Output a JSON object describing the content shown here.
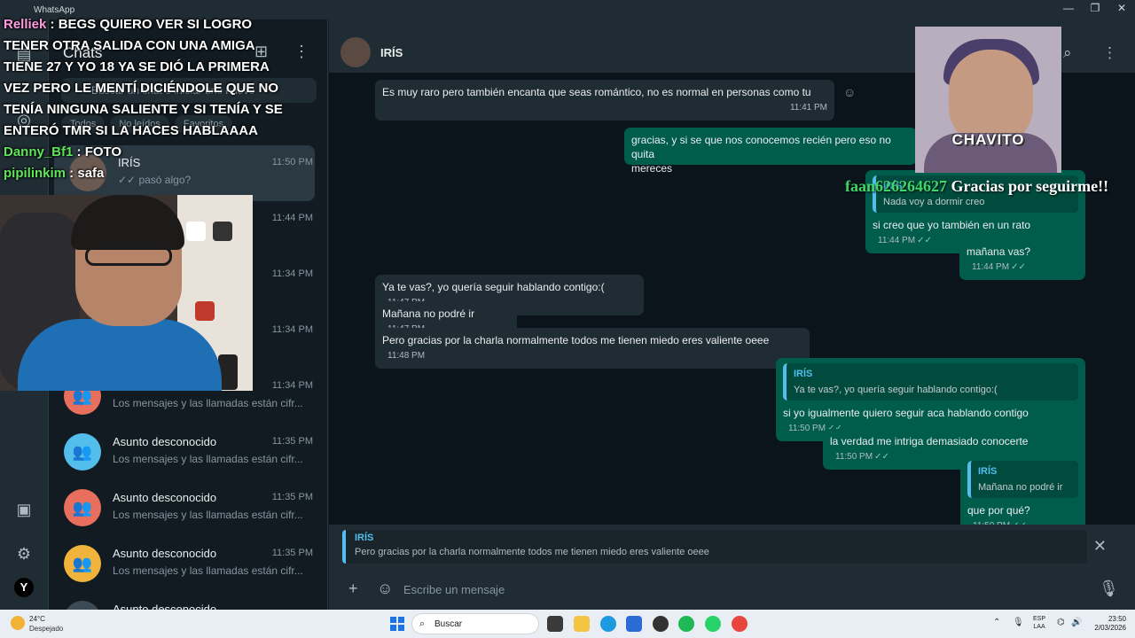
{
  "window": {
    "app_title": "WhatsApp",
    "controls": [
      "—",
      "❐",
      "✕"
    ]
  },
  "rail": {
    "icons": [
      "chats-icon",
      "status-icon",
      "channels-icon",
      "archive-icon",
      "settings-icon"
    ],
    "profile_initial": "Y"
  },
  "chat_list": {
    "title": "Chats",
    "search_placeholder": "Buscar un chat o iniciar uno nuevo",
    "filters": [
      "Todos",
      "No leídos",
      "Favoritos"
    ],
    "items": [
      {
        "name": "IRÍS",
        "time": "11:50 PM",
        "preview": "✓✓ pasó algo?",
        "color": "#6b5a52",
        "glyph": "",
        "active": true
      },
      {
        "name": "",
        "time": "11:44 PM",
        "preview": "",
        "color": "#3b4a54",
        "glyph": ""
      },
      {
        "name": "",
        "time": "11:34 PM",
        "preview": "están cifr...",
        "color": "#3b4a54",
        "glyph": ""
      },
      {
        "name": "",
        "time": "11:34 PM",
        "preview": "están cifr...",
        "color": "#3b4a54",
        "glyph": ""
      },
      {
        "name": "",
        "time": "11:34 PM",
        "preview": "Los mensajes y las llamadas están cifr...",
        "color": "#e86f5d",
        "glyph": "👥"
      },
      {
        "name": "Asunto desconocido",
        "time": "11:35 PM",
        "preview": "Los mensajes y las llamadas están cifr...",
        "color": "#53bdeb",
        "glyph": "👥"
      },
      {
        "name": "Asunto desconocido",
        "time": "11:35 PM",
        "preview": "Los mensajes y las llamadas están cifr...",
        "color": "#e86f5d",
        "glyph": "👥"
      },
      {
        "name": "Asunto desconocido",
        "time": "11:35 PM",
        "preview": "Los mensajes y las llamadas están cifr...",
        "color": "#f0b43c",
        "glyph": "👥"
      },
      {
        "name": "Asunto desconocido",
        "time": "",
        "preview": "",
        "color": "#3b4a54",
        "glyph": ""
      }
    ]
  },
  "chat": {
    "contact_name": "IRÍS",
    "messages": {
      "m1": {
        "text": "Es muy raro pero también encanta que seas romántico, no es normal en personas como tu",
        "time": "11:41 PM"
      },
      "m2": {
        "text": "gracias, y si se que nos conocemos recién pero eso no quita",
        "text2": "mereces"
      },
      "m3": {
        "quote_name": "IRÍS",
        "quote_text": "Nada voy a dormir creo",
        "text": "si creo que yo también en un rato",
        "time": "11:44 PM"
      },
      "m4": {
        "text": "mañana vas?",
        "time": "11:44 PM"
      },
      "m5": {
        "text": "Ya te vas?, yo quería seguir hablando contigo:(",
        "time": "11:47 PM"
      },
      "m6": {
        "text": "Mañana no podré ir",
        "time": "11:47 PM"
      },
      "m7": {
        "text": "Pero gracias por la charla normalmente todos me tienen miedo eres valiente oeee",
        "time": "11:48 PM"
      },
      "m8": {
        "quote_name": "IRÍS",
        "quote_text": "Ya te vas?, yo quería seguir hablando contigo:(",
        "text": "si yo igualmente quiero seguir aca hablando contigo",
        "time": "11:50 PM"
      },
      "m9": {
        "text": "la verdad me intriga demasiado conocerte",
        "time": "11:50 PM"
      },
      "m10": {
        "quote_name": "IRÍS",
        "quote_text": "Mañana no podré ir",
        "text": "que por qué?",
        "time": "11:50 PM"
      }
    },
    "reply": {
      "name": "IRÍS",
      "text": "Pero gracias por la charla normalmente todos me tienen miedo eres valiente oeee"
    },
    "composer_placeholder": "Escribe un mensaje"
  },
  "stream_overlay": {
    "chat_lines": [
      {
        "user": "Relliek",
        "text": " : BEGS QUIERO VER SI LOGRO TENER OTRA SALIDA CON UNA AMIGA TIENE 27 Y YO 18 YA SE DIÓ LA PRIMERA VEZ PERO LE MENTÍ DICIÉNDOLE QUE NO TENÍA NINGUNA SALIENTE Y SI TENÍA Y SE ENTERÓ TMR SI LA HACES HABLAAAA"
      },
      {
        "user": "Danny_Bf1",
        "text": " : FOTO"
      },
      {
        "user": "pipilinkim",
        "text": " : safa"
      }
    ],
    "sticker_label": "CHAVITO",
    "follow_user": "faan626264627",
    "follow_message": " Gracias por seguirme!!"
  },
  "taskbar": {
    "temperature": "24°C",
    "condition": "Despejado",
    "search_label": "Buscar",
    "lang_top": "ESP",
    "lang_bottom": "LAA",
    "time": "23:50",
    "date": "2/03/2026"
  },
  "colors": {
    "incoming_bubble": "#202c33",
    "outgoing_bubble": "#005c4b",
    "accent_blue": "#53bdeb",
    "background": "#0b141a"
  }
}
